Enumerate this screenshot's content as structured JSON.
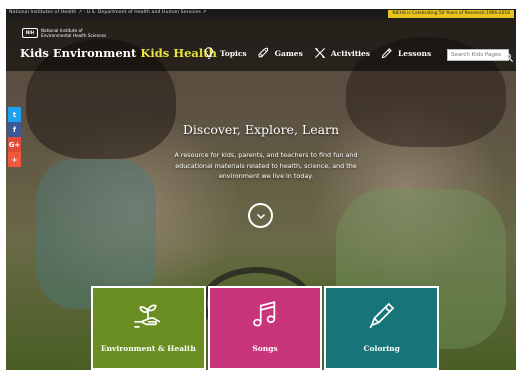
{
  "topbar": {
    "gov_links": "National Institutes of Health ↗  ·  U.S. Department of Health and Human Services ↗",
    "anniversary": "NIEHS is Celebrating 50 Years of Research 1966-2016"
  },
  "header": {
    "org_line1": "National Institute of",
    "org_line2": "Environmental Health Sciences",
    "org_mark": "NIH",
    "site_title_a": "Kids Environment",
    "site_title_b": "Kids Health"
  },
  "nav": [
    {
      "label": "Topics",
      "icon": "lightbulb-icon"
    },
    {
      "label": "Games",
      "icon": "rocket-icon"
    },
    {
      "label": "Activities",
      "icon": "tools-icon"
    },
    {
      "label": "Lessons",
      "icon": "pencil-icon"
    }
  ],
  "search": {
    "placeholder": "Search Kids Pages"
  },
  "social": [
    {
      "glyph": "t",
      "name": "twitter-icon",
      "color": "#1da1f2"
    },
    {
      "glyph": "f",
      "name": "facebook-icon",
      "color": "#3b5998"
    },
    {
      "glyph": "G+",
      "name": "google-plus-icon",
      "color": "#dd4b39"
    },
    {
      "glyph": "+",
      "name": "share-plus-icon",
      "color": "#f0593e"
    }
  ],
  "hero": {
    "tagline": "Discover, Explore, Learn",
    "intro": "A resource for kids, parents, and teachers to find fun and educational materials related to health, science, and the environment we live in today."
  },
  "tiles": [
    {
      "label": "Environment & Health",
      "color": "#6b8e23",
      "icon": "plant-hand-icon"
    },
    {
      "label": "Songs",
      "color": "#c8357a",
      "icon": "music-note-icon"
    },
    {
      "label": "Coloring",
      "color": "#17757a",
      "icon": "crayon-icon"
    }
  ],
  "colors": {
    "title_accent": "#e8e43c",
    "anniversary_bg": "#e8c41c"
  }
}
